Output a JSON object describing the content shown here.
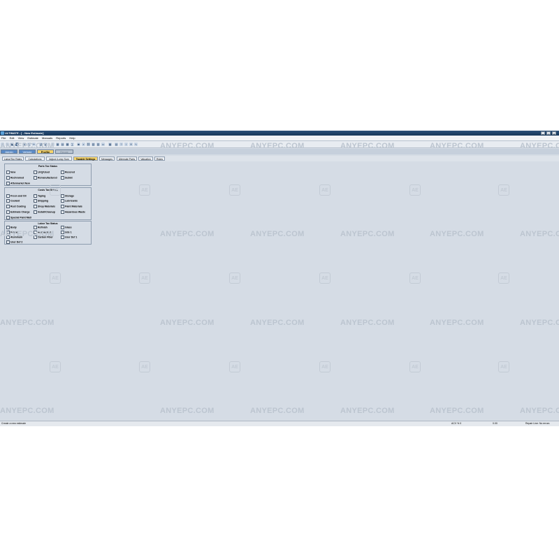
{
  "window": {
    "title": "ULTIMATE - [ - New Estimate]"
  },
  "menu": [
    "File",
    "Edit",
    "View",
    "Estimate",
    "Manuals",
    "Reports",
    "Help"
  ],
  "main_tabs": [
    {
      "label": "Admin",
      "active": false
    },
    {
      "label": "Vehicle",
      "active": false
    },
    {
      "label": "Profile",
      "active": true
    },
    {
      "label": "Repair",
      "active": false
    }
  ],
  "sub_tabs": [
    {
      "label": "Labor/Tax Rates",
      "active": false
    },
    {
      "label": "Calculations",
      "active": false
    },
    {
      "label": "Adjust./Lump Sum",
      "active": false
    },
    {
      "label": "Taxable Settings",
      "active": true
    },
    {
      "label": "Messages",
      "active": false
    },
    {
      "label": "Alternate Parts",
      "active": false
    },
    {
      "label": "Valuation",
      "active": false
    },
    {
      "label": "Rules",
      "active": false
    }
  ],
  "groups": {
    "parts": {
      "title": "Parts Tax Status",
      "items": [
        {
          "label": "New",
          "checked": true
        },
        {
          "label": "LKQ/Used",
          "checked": true
        },
        {
          "label": "Recored",
          "checked": true
        },
        {
          "label": "Rechromed",
          "checked": true
        },
        {
          "label": "Remanufactured",
          "checked": true
        },
        {
          "label": "Sublet",
          "checked": true
        },
        {
          "label": "Aftermarket New",
          "checked": true
        }
      ]
    },
    "costs": {
      "title": "Costs Tax Status",
      "items": [
        {
          "label": "Freon and Oil",
          "checked": true
        },
        {
          "label": "Taping",
          "checked": true
        },
        {
          "label": "Storage",
          "checked": true
        },
        {
          "label": "Coolant",
          "checked": true
        },
        {
          "label": "Shipping",
          "checked": true
        },
        {
          "label": "Lubricants",
          "checked": true
        },
        {
          "label": "Rust Coating",
          "checked": true
        },
        {
          "label": "Shop Materials",
          "checked": true
        },
        {
          "label": "Paint Materials",
          "checked": true
        },
        {
          "label": "Estimate Charge",
          "checked": true
        },
        {
          "label": "Install/Cleanup",
          "checked": true
        },
        {
          "label": "Hazardous Waste",
          "checked": true
        },
        {
          "label": "Special Paint Matl",
          "checked": true
        }
      ]
    },
    "labor": {
      "title": "Labor Tax Status",
      "items": [
        {
          "label": "Body",
          "checked": true
        },
        {
          "label": "Refinish",
          "checked": true
        },
        {
          "label": "Glass",
          "checked": true
        },
        {
          "label": "Frame",
          "checked": true
        },
        {
          "label": "Mechanical",
          "checked": true
        },
        {
          "label": "Uds 1",
          "checked": true
        },
        {
          "label": "Aluminum",
          "checked": true
        },
        {
          "label": "Carbon Fiber",
          "checked": true
        },
        {
          "label": "User Def 1",
          "checked": true
        },
        {
          "label": "User Def 2",
          "checked": true
        }
      ]
    }
  },
  "status": {
    "left": "Create a new estimate",
    "acv": "ACV % 0",
    "value": "0.00",
    "right": "Repair Line: No errors"
  },
  "watermark": {
    "text": "ANYEPC.COM",
    "badge": "AE"
  },
  "colors": {
    "title_bar": "#17375a",
    "active_tab": "#f7d46a",
    "tab_blue": "#5b8bc7",
    "workspace": "#d5dce5"
  }
}
